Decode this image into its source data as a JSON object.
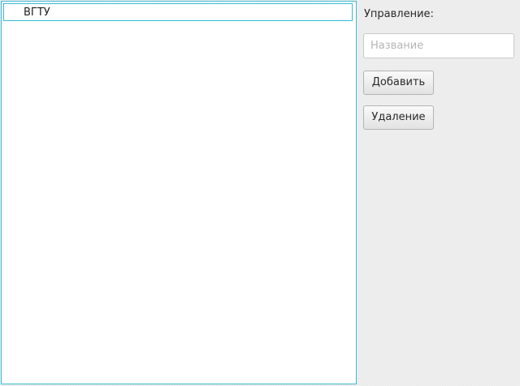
{
  "tree": {
    "items": [
      {
        "label": "ВГТУ"
      }
    ]
  },
  "sidebar": {
    "title": "Управление:",
    "name_input": {
      "value": "",
      "placeholder": "Название"
    },
    "add_label": "Добавить",
    "delete_label": "Удаление"
  },
  "colors": {
    "accent": "#3cb9d6"
  }
}
